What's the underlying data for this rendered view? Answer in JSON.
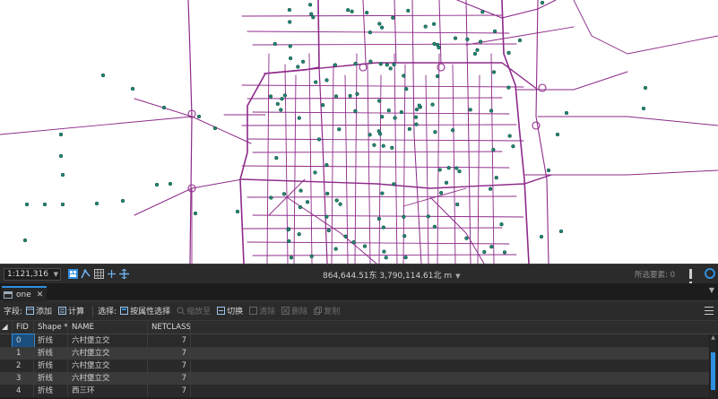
{
  "statusbar": {
    "scale": "1:121,316",
    "coordinates": "864,644.51东 3,790,114.61北 m",
    "selected_features": "所选要素: 0"
  },
  "table": {
    "tab_label": "one",
    "toolbar": {
      "fields_label": "字段:",
      "add_label": "添加",
      "calc_label": "计算",
      "selection_label": "选择:",
      "select_by_attr_label": "按属性选择",
      "zoom_to_label": "缩放至",
      "switch_label": "切换",
      "clear_label": "清除",
      "delete_label": "删除",
      "copy_label": "复制"
    },
    "columns": [
      "FID",
      "Shape *",
      "NAME",
      "NETCLASS"
    ],
    "rows": [
      {
        "fid": "0",
        "shape": "折线",
        "name": "六村堡立交",
        "netclass": "7"
      },
      {
        "fid": "1",
        "shape": "折线",
        "name": "六村堡立交",
        "netclass": "7"
      },
      {
        "fid": "2",
        "shape": "折线",
        "name": "六村堡立交",
        "netclass": "7"
      },
      {
        "fid": "3",
        "shape": "折线",
        "name": "六村堡立交",
        "netclass": "7"
      },
      {
        "fid": "4",
        "shape": "折线",
        "name": "西三环",
        "netclass": "7"
      }
    ]
  },
  "colors": {
    "road": "#8e2a8a",
    "point_fill": "#1f8a74",
    "accent": "#2f8fdf"
  }
}
